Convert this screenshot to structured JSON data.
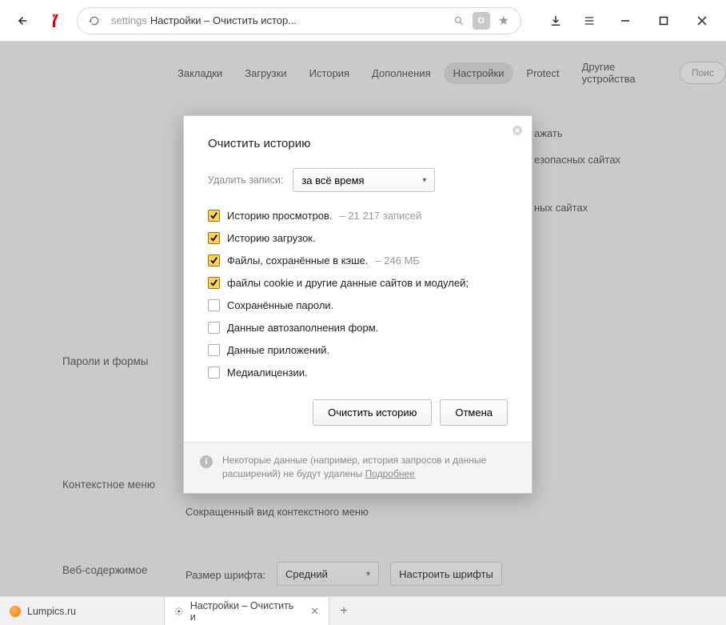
{
  "address": {
    "path_gray": "settings",
    "path_black": "Настройки – Очистить истор...",
    "badge_letter": "О"
  },
  "tabs": {
    "items": [
      "Закладки",
      "Загрузки",
      "История",
      "Дополнения",
      "Настройки",
      "Protect",
      "Другие устройства"
    ],
    "active_index": 4,
    "search_placeholder": "Поис"
  },
  "bg": {
    "line1_suffix": "ажать",
    "line2_suffix": "езопасных сайтах",
    "line3_suffix": "ных сайтах",
    "section_passwords": "Пароли и формы",
    "section_context": "Контекстное меню",
    "context_sub": "Сокращенный вид контекстного меню",
    "section_web": "Веб-содержимое",
    "font_label": "Размер шрифта:",
    "font_value": "Средний",
    "font_btn": "Настроить шрифты"
  },
  "dialog": {
    "title": "Очистить историю",
    "time_label": "Удалить записи:",
    "time_value": "за всё время",
    "items": [
      {
        "label": "Историю просмотров.",
        "extra": "– 21 217 записей",
        "checked": true
      },
      {
        "label": "Историю загрузок.",
        "extra": "",
        "checked": true
      },
      {
        "label": "Файлы, сохранённые в кэше.",
        "extra": "– 246 МБ",
        "checked": true
      },
      {
        "label": "файлы cookie и другие данные сайтов и модулей;",
        "extra": "",
        "checked": true
      },
      {
        "label": "Сохранённые пароли.",
        "extra": "",
        "checked": false
      },
      {
        "label": "Данные автозаполнения форм.",
        "extra": "",
        "checked": false
      },
      {
        "label": "Данные приложений.",
        "extra": "",
        "checked": false
      },
      {
        "label": "Медиалицензии.",
        "extra": "",
        "checked": false
      }
    ],
    "btn_clear": "Очистить историю",
    "btn_cancel": "Отмена",
    "note_text": "Некоторые данные (например, история запросов и данные расширений) не будут удалены ",
    "note_link": "Подробнее"
  },
  "taskbar": {
    "tab1": "Lumpics.ru",
    "tab2": "Настройки – Очистить и"
  }
}
